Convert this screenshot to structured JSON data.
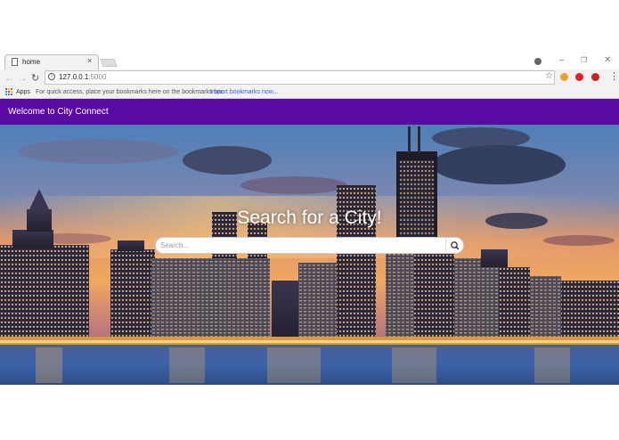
{
  "browser": {
    "tab_title": "home",
    "tab_close": "×",
    "url_host": "127.0.0.1",
    "url_port": ":5000",
    "win_minimize": "–",
    "win_restore": "❐",
    "win_close": "✕",
    "nav_back": "←",
    "nav_forward": "→",
    "nav_reload": "↻",
    "star": "☆",
    "menu": "⋮",
    "extensions": [
      {
        "name": "cookie-extension-icon",
        "color": "#f0a030"
      },
      {
        "name": "opera-extension-icon",
        "color": "#e0202a"
      },
      {
        "name": "adblock-extension-icon",
        "color": "#cc1f1f"
      }
    ]
  },
  "bookmarks_bar": {
    "apps_label": "Apps",
    "hint": "For quick access, place your bookmarks here on the bookmarks bar.",
    "import_link": "Import bookmarks now..."
  },
  "app": {
    "title": "Welcome to City Connect",
    "header_color": "#5a0aa0"
  },
  "hero": {
    "heading": "Search for a City!",
    "search_placeholder": "Search...",
    "search_icon": "search-icon"
  }
}
